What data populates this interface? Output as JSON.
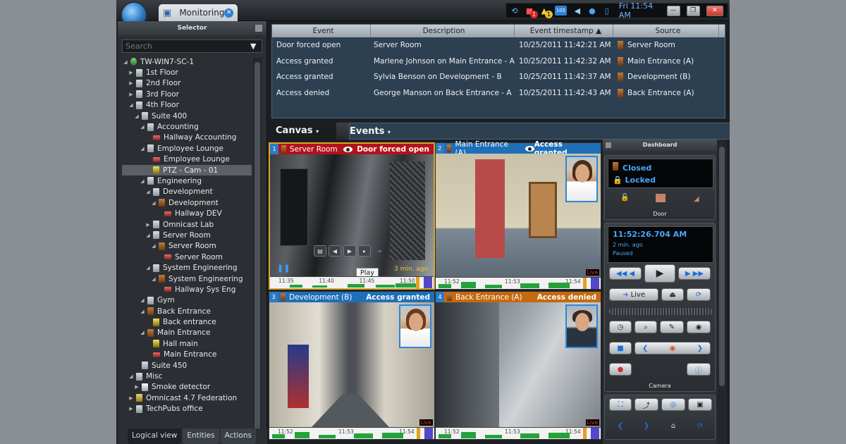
{
  "titlebar": {
    "tab_label": "Monitoring",
    "tab_close": "✕",
    "clock": "Fri 11:54 AM",
    "badges": {
      "alarms": "1",
      "warnings": "1",
      "notifications": "105"
    },
    "icons": [
      "history-icon",
      "alarm-icon",
      "warning-icon",
      "notification-icon",
      "volume-icon",
      "globe-icon",
      "device-icon"
    ]
  },
  "selector": {
    "title": "Selector",
    "search_placeholder": "Search",
    "tree": [
      {
        "label": "TW-WIN7-SC-1",
        "level": 0,
        "icon": "server",
        "expand": "◢"
      },
      {
        "label": "1st Floor",
        "level": 1,
        "icon": "area",
        "expand": "▶"
      },
      {
        "label": "2nd Floor",
        "level": 1,
        "icon": "area",
        "expand": "▶"
      },
      {
        "label": "3rd Floor",
        "level": 1,
        "icon": "area",
        "expand": "▶"
      },
      {
        "label": "4th Floor",
        "level": 1,
        "icon": "area",
        "expand": "◢"
      },
      {
        "label": "Suite 400",
        "level": 2,
        "icon": "area",
        "expand": "◢"
      },
      {
        "label": "Accounting",
        "level": 3,
        "icon": "area",
        "expand": "◢"
      },
      {
        "label": "Hallway Accounting",
        "level": 4,
        "icon": "camera",
        "expand": ""
      },
      {
        "label": "Employee Lounge",
        "level": 3,
        "icon": "area",
        "expand": "◢"
      },
      {
        "label": "Employee Lounge",
        "level": 4,
        "icon": "camera",
        "expand": ""
      },
      {
        "label": "PTZ - Cam - 01",
        "level": 4,
        "icon": "ptz",
        "expand": "",
        "selected": true
      },
      {
        "label": "Engineering",
        "level": 3,
        "icon": "area",
        "expand": "◢"
      },
      {
        "label": "Development",
        "level": 4,
        "icon": "area",
        "expand": "◢"
      },
      {
        "label": "Development",
        "level": 5,
        "icon": "door",
        "expand": "◢"
      },
      {
        "label": "Hallway DEV",
        "level": 6,
        "icon": "camera",
        "expand": ""
      },
      {
        "label": "Omnicast Lab",
        "level": 4,
        "icon": "area",
        "expand": "▶"
      },
      {
        "label": "Server Room",
        "level": 4,
        "icon": "area",
        "expand": "◢"
      },
      {
        "label": "Server Room",
        "level": 5,
        "icon": "door",
        "expand": "◢"
      },
      {
        "label": "Server Room",
        "level": 6,
        "icon": "camera",
        "expand": ""
      },
      {
        "label": "System Engineering",
        "level": 4,
        "icon": "area",
        "expand": "◢"
      },
      {
        "label": "System Engineering",
        "level": 5,
        "icon": "door",
        "expand": "◢"
      },
      {
        "label": "Hallway Sys Eng",
        "level": 6,
        "icon": "camera",
        "expand": ""
      },
      {
        "label": "Gym",
        "level": 3,
        "icon": "area",
        "expand": "◢"
      },
      {
        "label": "Back Entrance",
        "level": 3,
        "icon": "door",
        "expand": "◢"
      },
      {
        "label": "Back entrance",
        "level": 4,
        "icon": "ptz",
        "expand": ""
      },
      {
        "label": "Main Entrance",
        "level": 3,
        "icon": "door",
        "expand": "◢"
      },
      {
        "label": "Hall main",
        "level": 4,
        "icon": "ptz",
        "expand": ""
      },
      {
        "label": "Main Entrance",
        "level": 4,
        "icon": "camera",
        "expand": ""
      },
      {
        "label": "Suite 450",
        "level": 2,
        "icon": "area",
        "expand": ""
      },
      {
        "label": "Misc",
        "level": 1,
        "icon": "area",
        "expand": "◢"
      },
      {
        "label": "Smoke detector",
        "level": 2,
        "icon": "detector",
        "expand": "▶"
      },
      {
        "label": "Omnicast 4.7 Federation",
        "level": 1,
        "icon": "federation",
        "expand": "▶"
      },
      {
        "label": "TechPubs office",
        "level": 1,
        "icon": "area",
        "expand": "▶"
      }
    ],
    "tabs": [
      {
        "label": "Logical view",
        "active": true
      },
      {
        "label": "Entities",
        "active": false
      },
      {
        "label": "Actions",
        "active": false
      }
    ]
  },
  "events_table": {
    "columns": [
      "Event",
      "Description",
      "Event timestamp",
      "Source"
    ],
    "sort_indicator": "▲",
    "rows": [
      {
        "event": "Door forced open",
        "description": "Server Room",
        "timestamp": "10/25/2011 11:42:21 AM",
        "source": "Server Room"
      },
      {
        "event": "Access granted",
        "description": "Marlene Johnson on Main Entrance - A",
        "timestamp": "10/25/2011 11:42:32 AM",
        "source": "Main Entrance (A)"
      },
      {
        "event": "Access granted",
        "description": "Sylvia Benson on Development - B",
        "timestamp": "10/25/2011 11:42:37 AM",
        "source": "Development (B)"
      },
      {
        "event": "Access denied",
        "description": "George Manson on Back Entrance - A",
        "timestamp": "10/25/2011 11:42:43 AM",
        "source": "Back Entrance (A)"
      }
    ]
  },
  "canvas_tabs": {
    "canvas": "Canvas",
    "events": "Events"
  },
  "tiles": [
    {
      "num": "1",
      "door": "Server Room",
      "state": "Door forced open",
      "head_color": "#b3121a",
      "tooltip": "Play",
      "ago": "3 min. ago",
      "ticks": [
        "11:35",
        "11:40",
        "11:45",
        "11:50"
      ]
    },
    {
      "num": "2",
      "door": "Main Entrance (A)",
      "state": "Access granted",
      "head_color": "#1f6fb8",
      "live": "Live",
      "ticks": [
        "11:52",
        "11:53",
        "11:54"
      ]
    },
    {
      "num": "3",
      "door": "Development (B)",
      "state": "Access granted",
      "head_color": "#1f6fb8",
      "live": "Live",
      "ticks": [
        "11:52",
        "11:53",
        "11:54"
      ]
    },
    {
      "num": "4",
      "door": "Back Entrance (A)",
      "state": "Access denied",
      "head_color": "#c46a10",
      "live": "Live",
      "ticks": [
        "11:52",
        "11:53",
        "11:54"
      ]
    }
  ],
  "dashboard": {
    "title": "Dashboard",
    "door_status": "Closed",
    "lock_status": "Locked",
    "door_label": "Door",
    "camera_time": "11:52:26.704 AM",
    "camera_ago": "2 min. ago",
    "camera_state": "Paused",
    "live_label": "Live",
    "camera_label": "Camera"
  }
}
